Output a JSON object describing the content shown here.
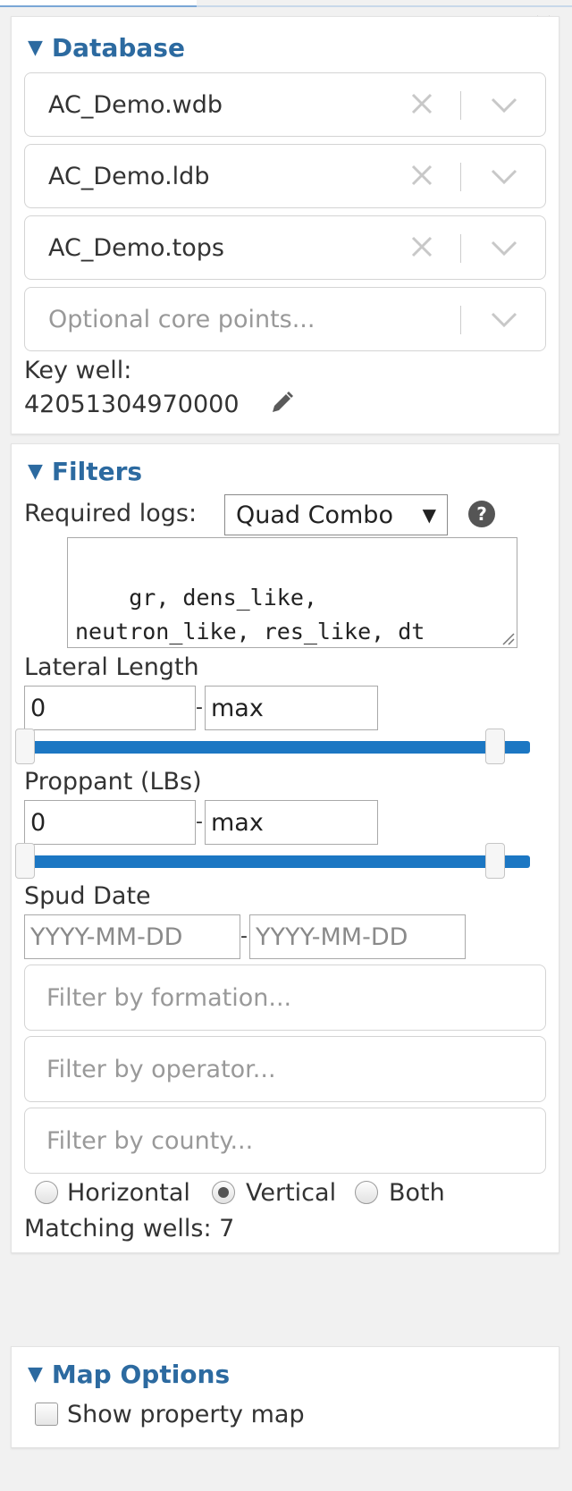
{
  "colors": {
    "accent": "#2c6aa0",
    "slider": "#1c77c3",
    "panel_bg": "#ffffff",
    "page_bg": "#f1f1f1"
  },
  "icons": {
    "collapse": "double-chevron-right-icon",
    "clear": "close-icon",
    "dropdown": "chevron-down-icon",
    "edit": "pencil-icon",
    "help": "question-circle-icon"
  },
  "database": {
    "title": "Database",
    "selects": [
      {
        "value": "AC_Demo.wdb",
        "placeholder": false
      },
      {
        "value": "AC_Demo.ldb",
        "placeholder": false
      },
      {
        "value": "AC_Demo.tops",
        "placeholder": false
      },
      {
        "value": "Optional core points...",
        "placeholder": true
      }
    ],
    "key_well_label": "Key well:",
    "key_well_value": "42051304970000"
  },
  "filters": {
    "title": "Filters",
    "required_logs_label": "Required logs:",
    "required_logs_value": "Quad Combo",
    "required_logs_caret": "▼",
    "required_logs_text": "gr, dens_like,\nneutron_like, res_like, dt",
    "lateral_length": {
      "label": "Lateral Length",
      "min": "0",
      "max": "max",
      "dash": "-",
      "range_fraction": [
        0,
        1
      ]
    },
    "proppant": {
      "label": "Proppant (LBs)",
      "min": "0",
      "max": "max",
      "dash": "-",
      "range_fraction": [
        0,
        1
      ]
    },
    "spud_date": {
      "label": "Spud Date",
      "from_placeholder": "YYYY-MM-DD",
      "to_placeholder": "YYYY-MM-DD",
      "dash": "-"
    },
    "formation_placeholder": "Filter by formation...",
    "operator_placeholder": "Filter by operator...",
    "county_placeholder": "Filter by county...",
    "orientation_options": [
      "Horizontal",
      "Vertical",
      "Both"
    ],
    "orientation_selected": "Vertical",
    "matching_wells": "Matching wells: 7"
  },
  "map_options": {
    "title": "Map Options",
    "show_property_map_label": "Show property map",
    "show_property_map_checked": false
  }
}
